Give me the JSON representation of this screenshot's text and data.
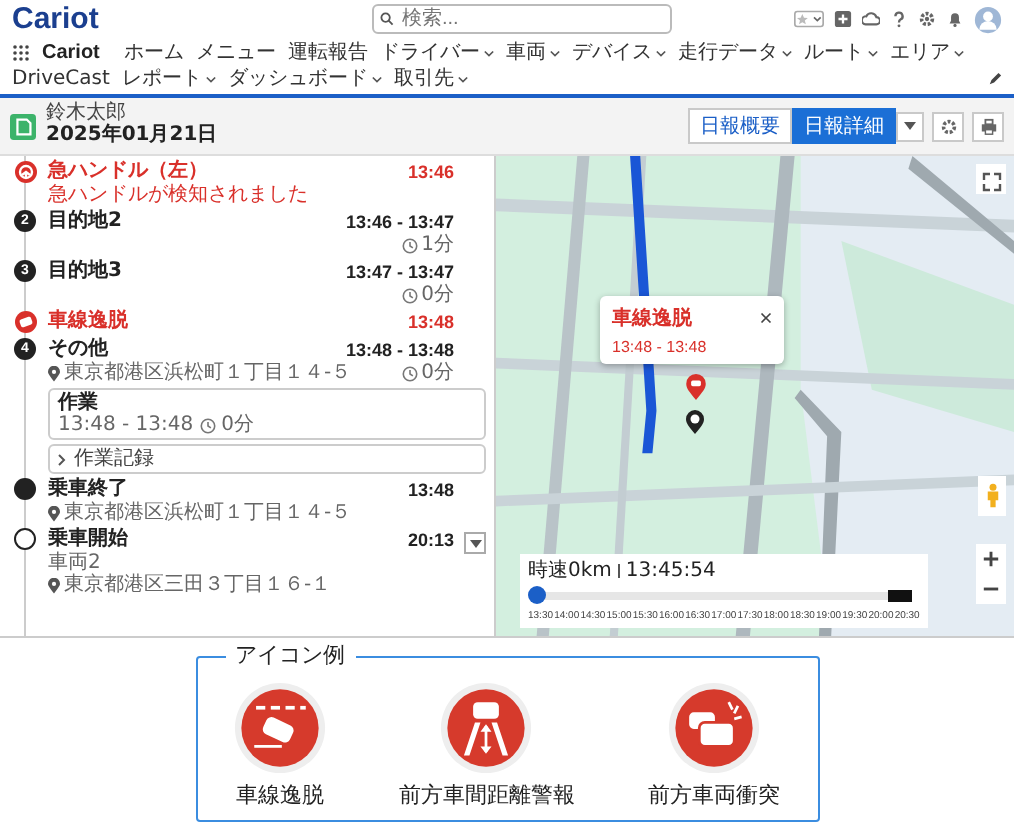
{
  "header": {
    "logo": "Cariot",
    "search": {
      "placeholder": "検索..."
    }
  },
  "nav": {
    "app_name": "Cariot",
    "items": [
      {
        "label": "ホーム",
        "dropdown": false
      },
      {
        "label": "メニュー",
        "dropdown": false
      },
      {
        "label": "運転報告",
        "dropdown": false
      },
      {
        "label": "ドライバー",
        "dropdown": true
      },
      {
        "label": "車両",
        "dropdown": true
      },
      {
        "label": "デバイス",
        "dropdown": true
      },
      {
        "label": "走行データ",
        "dropdown": true
      },
      {
        "label": "ルート",
        "dropdown": true
      },
      {
        "label": "エリア",
        "dropdown": true
      },
      {
        "label": "DriveCast",
        "dropdown": false
      },
      {
        "label": "レポート",
        "dropdown": true
      },
      {
        "label": "ダッシュボード",
        "dropdown": true
      },
      {
        "label": "取引先",
        "dropdown": true
      }
    ]
  },
  "record": {
    "driver": "鈴木太郎",
    "date": "2025年01月21日",
    "view_buttons": [
      {
        "label": "日報概要",
        "selected": false
      },
      {
        "label": "日報詳細",
        "selected": true
      }
    ]
  },
  "timeline": [
    {
      "kind": "sharp_turn",
      "title": "急ハンドル（左）",
      "time": "13:46",
      "note": "急ハンドルが検知されました"
    },
    {
      "kind": "stop",
      "number": "2",
      "title": "目的地2",
      "time": "13:46 - 13:47",
      "duration": "1分"
    },
    {
      "kind": "stop",
      "number": "3",
      "title": "目的地3",
      "time": "13:47 - 13:47",
      "duration": "0分"
    },
    {
      "kind": "lane_departure",
      "title": "車線逸脱",
      "time": "13:48"
    },
    {
      "kind": "stop",
      "number": "4",
      "title": "その他",
      "time": "13:48 - 13:48",
      "address": "東京都港区浜松町１丁目１４-５",
      "duration": "0分",
      "tasks": [
        {
          "title": "作業",
          "time": "13:48 - 13:48",
          "duration": "0分"
        }
      ],
      "record_link": "作業記録"
    },
    {
      "kind": "end",
      "title": "乗車終了",
      "time": "13:48",
      "address": "東京都港区浜松町１丁目１４-５"
    },
    {
      "kind": "start",
      "title": "乗車開始",
      "time": "20:13",
      "vehicle": "車両2",
      "address": "東京都港区三田３丁目１６-１",
      "expandable": true
    }
  ],
  "map": {
    "popup": {
      "title": "車線逸脱",
      "time": "13:48 - 13:48"
    },
    "playback": {
      "speed": "時速0km",
      "clock": "13:45:54",
      "level": 0,
      "ticks": [
        "13:30",
        "14:00",
        "14:30",
        "15:00",
        "15:30",
        "16:00",
        "16:30",
        "17:00",
        "17:30",
        "18:00",
        "18:30",
        "19:00",
        "19:30",
        "20:00",
        "20:30"
      ]
    }
  },
  "legend": {
    "title": "アイコン例",
    "items": [
      {
        "kind": "lane_departure",
        "label": "車線逸脱"
      },
      {
        "kind": "following_distance",
        "label": "前方車間距離警報"
      },
      {
        "kind": "collision",
        "label": "前方車両衝突"
      }
    ]
  }
}
